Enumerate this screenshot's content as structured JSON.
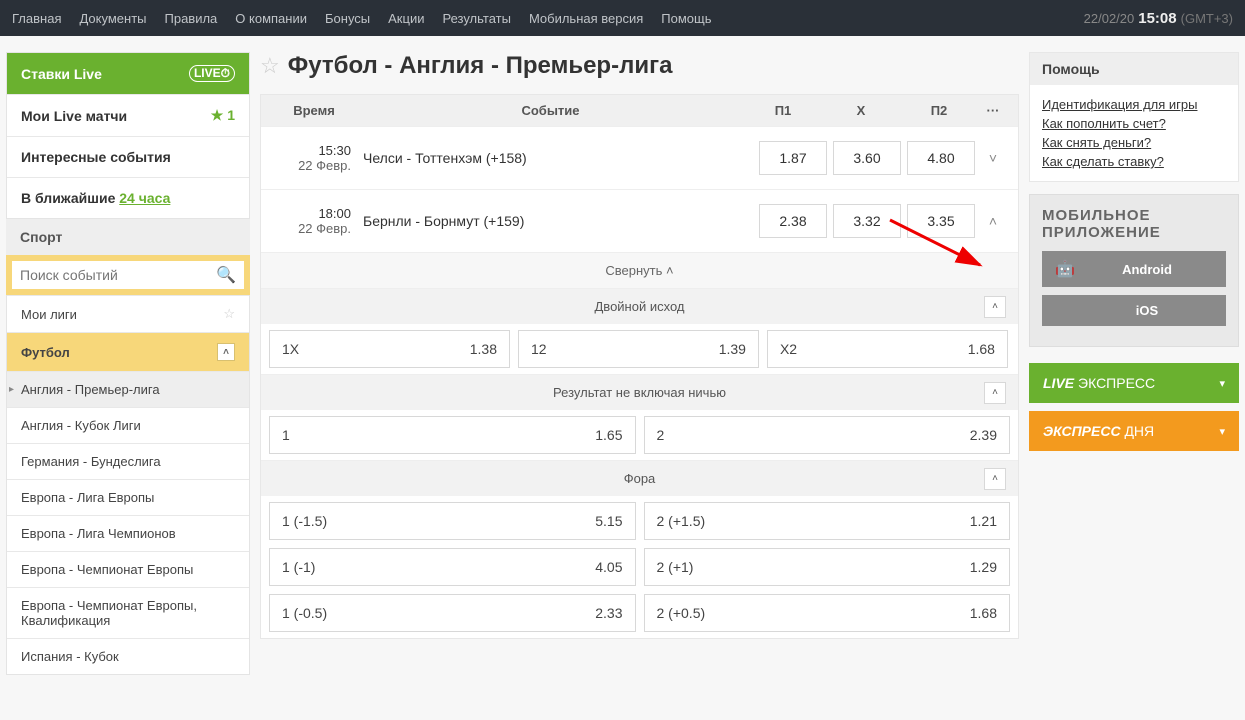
{
  "topnav": {
    "items": [
      "Главная",
      "Документы",
      "Правила",
      "О компании",
      "Бонусы",
      "Акции",
      "Результаты",
      "Мобильная версия",
      "Помощь"
    ],
    "date": "22/02/20",
    "time": "15:08",
    "tz": "(GMT+3)"
  },
  "sidebar": {
    "live_title": "Ставки Live",
    "my_live": "Мои Live матчи",
    "my_live_count": "1",
    "interesting": "Интересные события",
    "coming_label": "В ближайшие",
    "coming_link": "24 часа",
    "sport_h": "Спорт",
    "search_placeholder": "Поиск событий",
    "my_leagues": "Мои лиги",
    "football": "Футбол",
    "leagues": [
      "Англия - Премьер-лига",
      "Англия - Кубок Лиги",
      "Германия - Бундеслига",
      "Европа - Лига Европы",
      "Европа - Лига Чемпионов",
      "Европа - Чемпионат Европы",
      "Европа - Чемпионат Европы, Квалификация",
      "Испания - Кубок"
    ]
  },
  "page": {
    "title": "Футбол - Англия - Премьер-лига"
  },
  "table_head": {
    "time": "Время",
    "event": "Событие",
    "p1": "П1",
    "x": "X",
    "p2": "П2",
    "more": "···"
  },
  "events": [
    {
      "time": "15:30",
      "date": "22 Февр.",
      "name": "Челси - Тоттенхэм (+158)",
      "p1": "1.87",
      "x": "3.60",
      "p2": "4.80",
      "expanded": false
    },
    {
      "time": "18:00",
      "date": "22 Февр.",
      "name": "Бернли - Борнмут (+159)",
      "p1": "2.38",
      "x": "3.32",
      "p2": "3.35",
      "expanded": true
    }
  ],
  "collapse_label": "Свернуть",
  "markets": {
    "double": {
      "title": "Двойной исход",
      "sel": [
        {
          "n": "1X",
          "v": "1.38"
        },
        {
          "n": "12",
          "v": "1.39"
        },
        {
          "n": "X2",
          "v": "1.68"
        }
      ]
    },
    "dnb": {
      "title": "Результат не включая ничью",
      "sel": [
        {
          "n": "1",
          "v": "1.65"
        },
        {
          "n": "2",
          "v": "2.39"
        }
      ]
    },
    "handicap": {
      "title": "Фора",
      "rows": [
        [
          {
            "n": "1 (-1.5)",
            "v": "5.15"
          },
          {
            "n": "2 (+1.5)",
            "v": "1.21"
          }
        ],
        [
          {
            "n": "1 (-1)",
            "v": "4.05"
          },
          {
            "n": "2 (+1)",
            "v": "1.29"
          }
        ],
        [
          {
            "n": "1 (-0.5)",
            "v": "2.33"
          },
          {
            "n": "2 (+0.5)",
            "v": "1.68"
          }
        ]
      ]
    }
  },
  "help": {
    "title": "Помощь",
    "links": [
      "Идентификация для игры",
      "Как пополнить счет?",
      "Как снять деньги?",
      "Как сделать ставку?"
    ]
  },
  "mobile": {
    "title": "МОБИЛЬНОЕ ПРИЛОЖЕНИЕ",
    "android": "Android",
    "ios": "iOS"
  },
  "promo": {
    "live_b": "LIVE",
    "live_t": "ЭКСПРЕСС",
    "day_b": "ЭКСПРЕСС",
    "day_t": "ДНЯ"
  }
}
